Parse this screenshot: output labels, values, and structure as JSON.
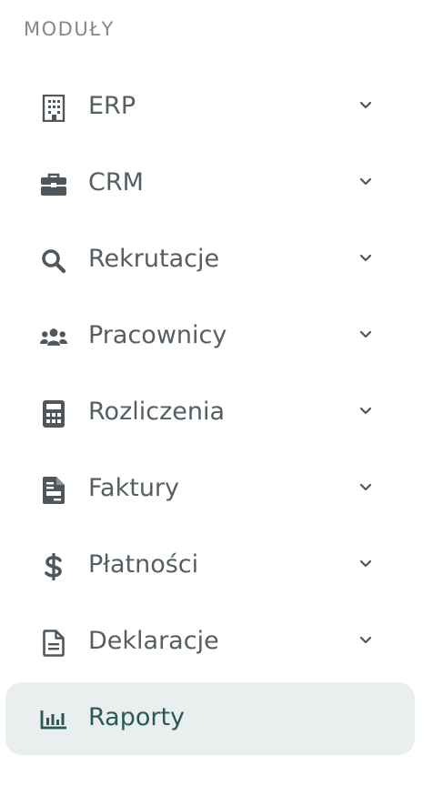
{
  "sidebar": {
    "section_title": "MODUŁY",
    "items": [
      {
        "label": "ERP",
        "icon": "building-icon",
        "expandable": true,
        "active": false
      },
      {
        "label": "CRM",
        "icon": "briefcase-icon",
        "expandable": true,
        "active": false
      },
      {
        "label": "Rekrutacje",
        "icon": "search-icon",
        "expandable": true,
        "active": false
      },
      {
        "label": "Pracownicy",
        "icon": "users-icon",
        "expandable": true,
        "active": false
      },
      {
        "label": "Rozliczenia",
        "icon": "calculator-icon",
        "expandable": true,
        "active": false
      },
      {
        "label": "Faktury",
        "icon": "invoice-icon",
        "expandable": true,
        "active": false
      },
      {
        "label": "Płatności",
        "icon": "dollar-icon",
        "expandable": true,
        "active": false
      },
      {
        "label": "Deklaracje",
        "icon": "document-icon",
        "expandable": true,
        "active": false
      },
      {
        "label": "Raporty",
        "icon": "bar-chart-icon",
        "expandable": false,
        "active": true
      }
    ]
  },
  "colors": {
    "text": "#555e63",
    "icon": "#4f575c",
    "heading": "#7f8a90",
    "active_bg": "#e9eeee",
    "active_text": "#2a5955"
  }
}
